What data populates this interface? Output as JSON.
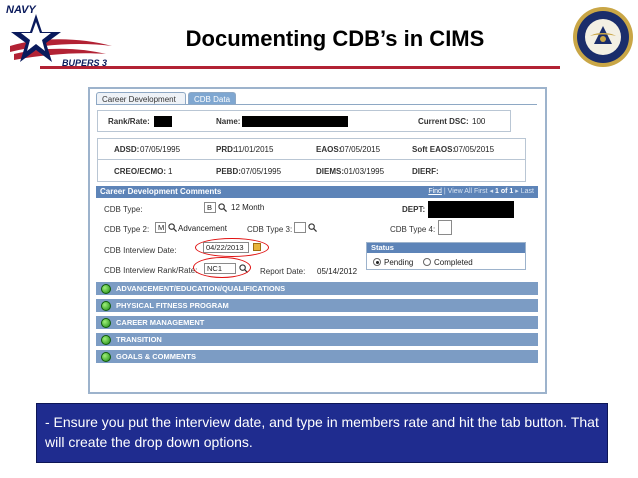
{
  "slide": {
    "title": "Documenting CDB’s in CIMS",
    "logo_text_top": "NAVY",
    "logo_text_bottom": "BUPERS 3",
    "note": "- Ensure you put the interview date, and type in members rate and hit the tab button. That will create the drop down options."
  },
  "tabs": [
    {
      "label": "Career Development",
      "active": false
    },
    {
      "label": "CDB Data",
      "active": true
    }
  ],
  "info1": {
    "rank_label": "Rank/Rate:",
    "name_label": "Name:",
    "dsc_label": "Current DSC:",
    "dsc_value": "100"
  },
  "info2": {
    "adsd_label": "ADSD:",
    "adsd_value": "07/05/1995",
    "prd_label": "PRD:",
    "prd_value": "11/01/2015",
    "eaos_label": "EAOS:",
    "eaos_value": "07/05/2015",
    "soft_eaos_label": "Soft EAOS:",
    "soft_eaos_value": "07/05/2015",
    "creo_label": "CREO/ECMO:",
    "creo_value": "1",
    "pebd_label": "PEBD:",
    "pebd_value": "07/05/1995",
    "diems_label": "DIEMS:",
    "diems_value": "01/03/1995",
    "dierf_label": "DIERF:"
  },
  "comments": {
    "header": "Career Development Comments",
    "nav_find": "Find",
    "nav_view_all": "View All",
    "nav_first": "First",
    "nav_range": "1 of 1",
    "nav_last": "Last",
    "cdb_type_label": "CDB Type:",
    "cdb_type_value": "B",
    "cdb_type_desc": "12 Month",
    "dept_label": "DEPT:",
    "cdb_type2_label": "CDB Type 2:",
    "cdb_type2_value": "M",
    "cdb_type2_desc": "Advancement",
    "cdb_type3_label": "CDB Type 3:",
    "cdb_type4_label": "CDB Type 4:",
    "interview_date_label": "CDB Interview Date:",
    "interview_date_value": "04/22/2013",
    "interview_rank_label": "CDB Interview Rank/Rate:",
    "interview_rank_value": "NC1",
    "report_date_label": "Report Date:",
    "report_date_value": "05/14/2012",
    "status_header": "Status",
    "status_pending": "Pending",
    "status_completed": "Completed",
    "status_selected": "Pending"
  },
  "sections": [
    "ADVANCEMENT/EDUCATION/QUALIFICATIONS",
    "PHYSICAL FITNESS PROGRAM",
    "CAREER MANAGEMENT",
    "TRANSITION",
    "GOALS & COMMENTS"
  ],
  "colors": {
    "title_rule": "#b22234",
    "section_blue": "#5d84b8",
    "collapse_blue": "#7c9cc4",
    "note_bg": "#1f2c8f",
    "highlight_ring": "#e01010"
  }
}
